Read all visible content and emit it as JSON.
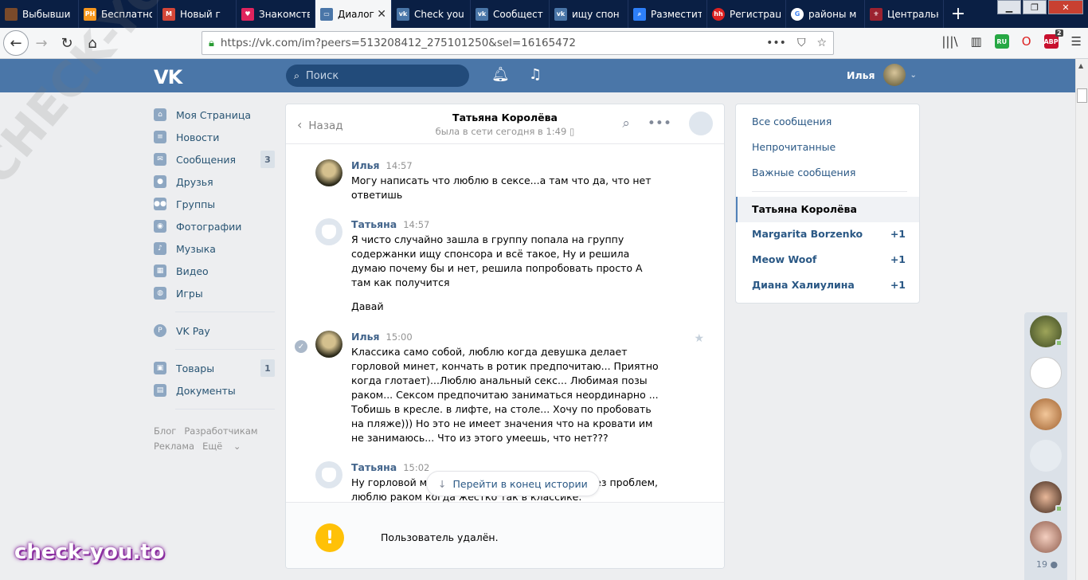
{
  "browser": {
    "tabs": [
      {
        "title": "Выбывши",
        "icon_color": "#7a4a2a"
      },
      {
        "title": "Бесплатно",
        "icon_color": "#f7971d"
      },
      {
        "title": "Новый г",
        "icon_color": "#d44638"
      },
      {
        "title": "Знакомств",
        "icon_color": "#e0245e"
      },
      {
        "title": "Диалог",
        "icon_color": "#4a76a8",
        "active": true
      },
      {
        "title": "Check you",
        "icon_color": "#4a76a8"
      },
      {
        "title": "Сообщест",
        "icon_color": "#4a76a8"
      },
      {
        "title": "ищу спон",
        "icon_color": "#4a76a8"
      },
      {
        "title": "Разместит",
        "icon_color": "#2d7ff9"
      },
      {
        "title": "Регистрац",
        "icon_color": "#d22"
      },
      {
        "title": "районы м",
        "icon_color": "#4285f4"
      },
      {
        "title": "Центральн",
        "icon_color": "#9c2230"
      }
    ],
    "new_tab": "+",
    "url": "https://vk.com/im?peers=513208412_275101250&sel=16165472",
    "ext_ru": "RU",
    "ext_abp": "ABP",
    "ext_abp_badge": "2"
  },
  "vk": {
    "logo": "VK",
    "search_placeholder": "Поиск",
    "user_name": "Илья",
    "accent": "#4a76a8"
  },
  "menu": {
    "items": [
      {
        "label": "Моя Страница",
        "icon": "home-icon"
      },
      {
        "label": "Новости",
        "icon": "news-icon"
      },
      {
        "label": "Сообщения",
        "icon": "messages-icon",
        "badge": "3"
      },
      {
        "label": "Друзья",
        "icon": "friends-icon"
      },
      {
        "label": "Группы",
        "icon": "groups-icon"
      },
      {
        "label": "Фотографии",
        "icon": "camera-icon"
      },
      {
        "label": "Музыка",
        "icon": "music-icon"
      },
      {
        "label": "Видео",
        "icon": "video-icon"
      },
      {
        "label": "Игры",
        "icon": "games-icon"
      }
    ],
    "vkpay": "VK Pay",
    "market": "Товары",
    "market_badge": "1",
    "docs": "Документы",
    "footer": [
      "Блог",
      "Разработчикам",
      "Реклама",
      "Ещё"
    ]
  },
  "chat": {
    "back": "Назад",
    "peer_name": "Татьяна Королёва",
    "peer_status": "была в сети сегодня в 1:49",
    "messages": [
      {
        "author": "Илья",
        "time": "14:57",
        "text": "Могу написать что люблю в сексе...а там что да, что нет ответишь"
      },
      {
        "author": "Татьяна",
        "time": "14:57",
        "text": "Я чисто случайно зашла в группу попала на группу содержанки ищу спонсора и всё такое, Ну и решила думаю почему бы и нет, решила попробовать просто А там как получится",
        "text2": "Давай"
      },
      {
        "author": "Илья",
        "time": "15:00",
        "text": "Классика само собой, люблю когда девушка делает горловой минет, кончать в ротик предпочитаю... Приятно когда глотает)...Люблю анальный секс... Любимая позы раком... Сексом предпочитаю заниматься неординарно ... Тобишь в кресле. в лифте, на столе... Хочу по пробовать на пляже))) Но это не имеет значения что на кровати им не занимаюсь... Что из этого умеешь, что нет???"
      },
      {
        "author": "Татьяна",
        "time": "15:02",
        "text": "Ну горловой минет делаю, могу и сглотнуть без проблем, люблю раком когда жестко так в классике."
      }
    ],
    "goto_end": "Перейти в конец истории",
    "deleted_notice": "Пользователь удалён.",
    "warn_symbol": "!"
  },
  "right": {
    "all": "Все сообщения",
    "unread": "Непрочитанные",
    "important": "Важные сообщения",
    "selected": "Татьяна Королёва",
    "convs": [
      {
        "name": "Margarita Borzenko",
        "count": "+1"
      },
      {
        "name": "Meow Woof",
        "count": "+1"
      },
      {
        "name": "Диана Халиулина",
        "count": "+1"
      }
    ]
  },
  "friends_online": {
    "count": "19"
  },
  "watermark": "check-you.to",
  "watermark_diag": "CHECK-YOU.ME"
}
